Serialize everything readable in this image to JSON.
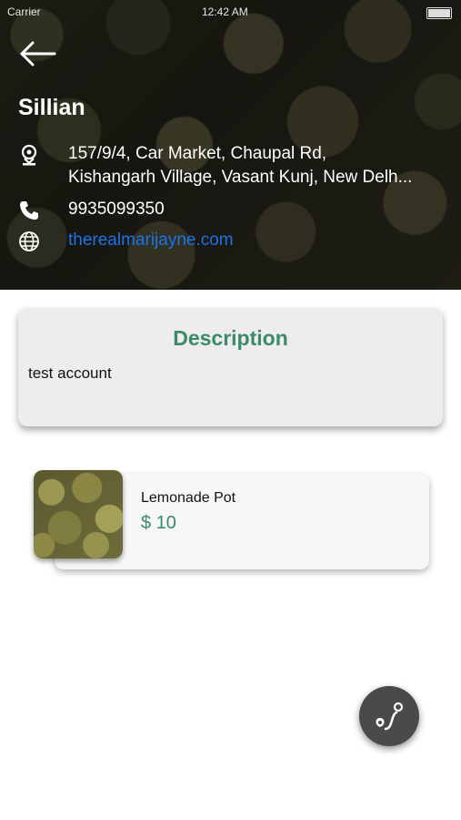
{
  "status_bar": {
    "carrier": "Carrier",
    "time": "12:42 AM"
  },
  "shop": {
    "name": "Sillian",
    "address_line1": "157/9/4, Car Market, Chaupal Rd,",
    "address_line2": "Kishangarh Village, Vasant Kunj, New Delh...",
    "phone": "9935099350",
    "website": "therealmarijayne.com"
  },
  "description": {
    "title": "Description",
    "text": "test account"
  },
  "products": [
    {
      "name": "Lemonade Pot",
      "price": "$ 10"
    }
  ],
  "colors": {
    "accent": "#3a8a6c",
    "link": "#1e73e8",
    "fab": "#4a4a4a"
  },
  "icons": [
    "back-arrow-icon",
    "location-pin-icon",
    "phone-icon",
    "globe-icon",
    "route-icon"
  ]
}
